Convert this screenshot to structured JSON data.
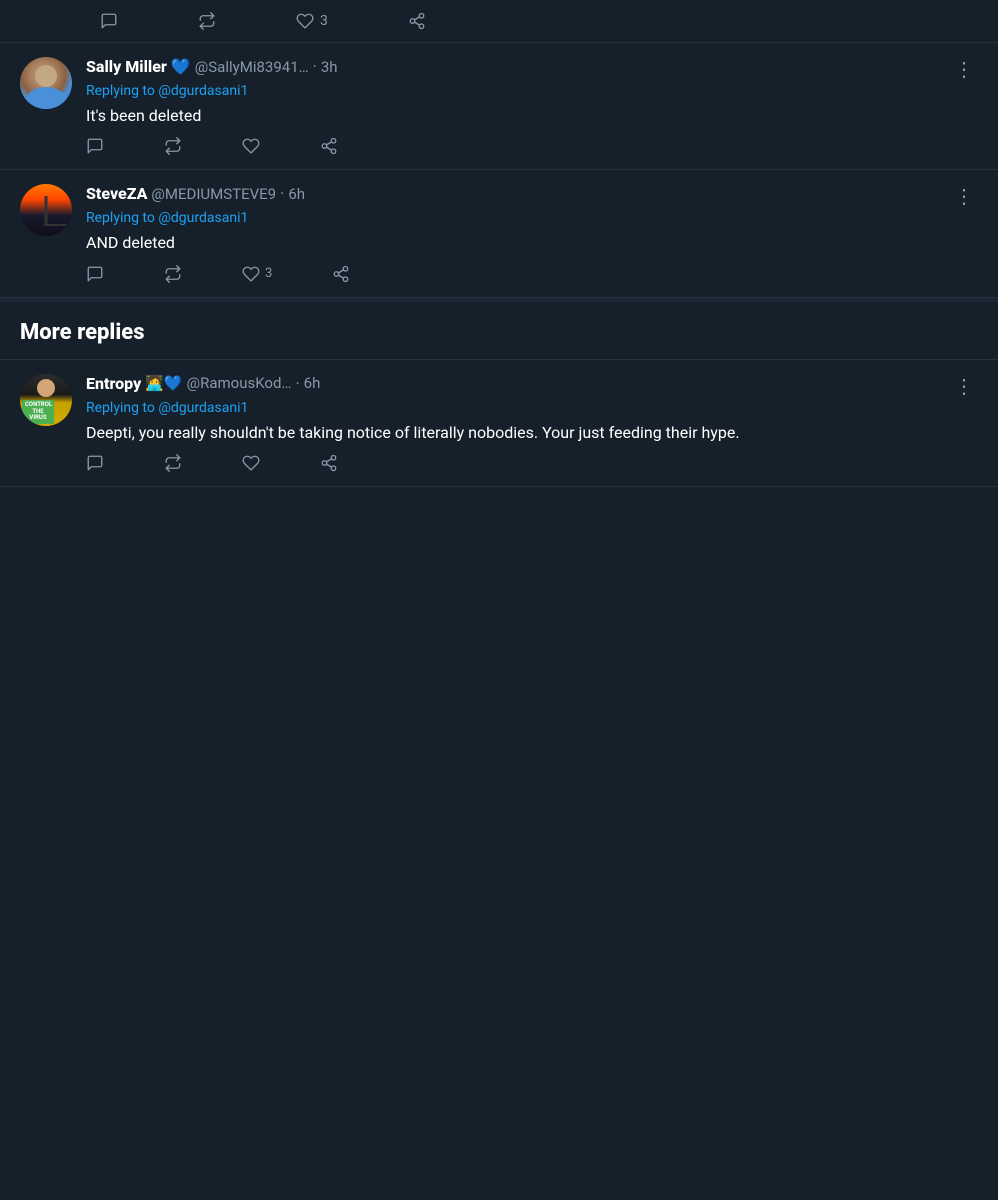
{
  "top_tweet": {
    "actions": {
      "reply_icon": "💬",
      "retweet_icon": "🔁",
      "like_icon": "♡",
      "like_count": "3",
      "share_icon": "⬆"
    }
  },
  "tweets": [
    {
      "id": "sally",
      "user_name": "Sally Miller",
      "verified": true,
      "user_handle": "@SallyMi83941…",
      "time": "3h",
      "reply_to": "@dgurdasani1",
      "text": "It's been deleted",
      "actions": {
        "reply": "",
        "retweet": "",
        "like": "",
        "like_count": "",
        "share": ""
      }
    },
    {
      "id": "steveza",
      "user_name": "SteveZA",
      "verified": false,
      "user_handle": "@MEDIUMSTEVE9",
      "time": "6h",
      "reply_to": "@dgurdasani1",
      "text": "AND deleted",
      "actions": {
        "reply": "",
        "retweet": "",
        "like": "",
        "like_count": "3",
        "share": ""
      }
    }
  ],
  "more_replies": {
    "title": "More replies",
    "tweets": [
      {
        "id": "entropy",
        "user_name": "Entropy",
        "emojis": "🧑‍💻💙",
        "verified": false,
        "user_handle": "@RamousKod…",
        "time": "6h",
        "reply_to": "@dgurdasani1",
        "text": "Deepti, you really shouldn't be taking notice of literally nobodies. Your just feeding their hype.",
        "actions": {
          "reply": "",
          "retweet": "",
          "like": "",
          "share": ""
        }
      }
    ]
  },
  "labels": {
    "replying_to": "Replying to"
  }
}
